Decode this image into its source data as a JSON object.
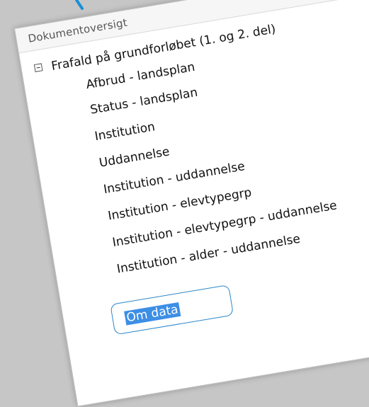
{
  "panel": {
    "title": "Dokumentoversigt"
  },
  "tree": {
    "root_label": "Frafald på grundforløbet (1. og 2. del)",
    "items": [
      {
        "label": "Afbrud - landsplan"
      },
      {
        "label": "Status - landsplan"
      },
      {
        "label": "Institution"
      },
      {
        "label": "Uddannelse"
      },
      {
        "label": "Institution - uddannelse"
      },
      {
        "label": "Institution - elevtypegrp"
      },
      {
        "label": "Institution - elevtypegrp - uddannelse"
      },
      {
        "label": "Institution - alder - uddannelse"
      }
    ],
    "selected_label": "Om data"
  },
  "icons": {
    "collapse": "collapse-icon"
  },
  "colors": {
    "background": "#c6c6c6",
    "selection": "#3d8ee5",
    "callout": "#2b86c9"
  }
}
